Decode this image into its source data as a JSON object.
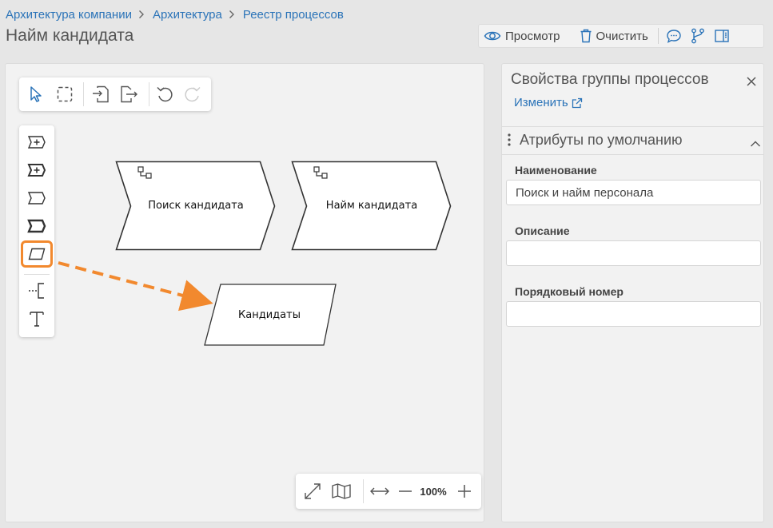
{
  "breadcrumb": [
    "Архитектура компании",
    "Архитектура",
    "Реестр процессов"
  ],
  "page_title": "Найм кандидата",
  "toolbar": {
    "preview_label": "Просмотр",
    "clear_label": "Очистить"
  },
  "canvas": {
    "shapes": [
      {
        "label": "Поиск кандидата"
      },
      {
        "label": "Найм кандидата"
      },
      {
        "label": "Кандидаты"
      }
    ],
    "zoom": "100%",
    "colors": {
      "accent": "#f2892e",
      "link": "#2a73b8"
    }
  },
  "panel": {
    "title": "Свойства группы процессов",
    "edit_label": "Изменить",
    "section_title": "Атрибуты по умолчанию",
    "fields": [
      {
        "label": "Наименование",
        "value": "Поиск и найм персонала",
        "placeholder": ""
      },
      {
        "label": "Описание",
        "value": "",
        "placeholder": ""
      },
      {
        "label": "Порядковый номер",
        "value": "",
        "placeholder": ""
      }
    ]
  }
}
